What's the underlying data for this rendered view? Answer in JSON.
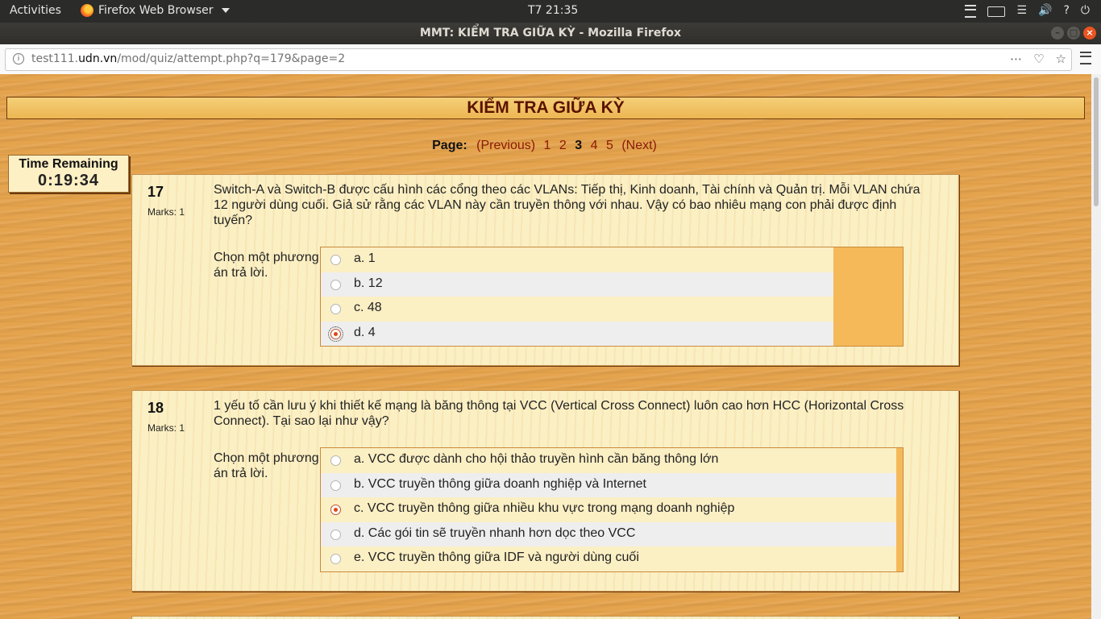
{
  "os": {
    "activities": "Activities",
    "app_name": "Firefox Web Browser",
    "clock": "T7 21:35"
  },
  "window": {
    "title": "MMT: KIỂM TRA GIỮA KỲ - Mozilla Firefox"
  },
  "browser": {
    "url_prefix": "test111.",
    "url_domain": "udn.vn",
    "url_path": "/mod/quiz/attempt.php?q=179&page=2"
  },
  "quiz": {
    "heading": "KIỂM TRA GIỮA KỲ",
    "paging": {
      "label": "Page:",
      "previous": "(Previous)",
      "pages": [
        "1",
        "2",
        "3",
        "4",
        "5"
      ],
      "current": "3",
      "next": "(Next)"
    },
    "timer": {
      "label": "Time Remaining",
      "value": "0:19:34"
    },
    "questions": [
      {
        "number": "17",
        "marks": "Marks: 1",
        "text": "Switch-A và Switch-B được cấu hình các cổng theo các VLANs: Tiếp thị, Kinh doanh, Tài chính và Quản trị. Mỗi VLAN chứa 12 người dùng cuối. Giả sử rằng các VLAN này cần truyền thông với nhau. Vậy có bao nhiêu mạng con phải được định tuyến?",
        "prompt": "Chọn một phương án trả lời.",
        "answers": [
          "a. 1",
          "b. 12",
          "c. 48",
          "d. 4"
        ],
        "selected": 3
      },
      {
        "number": "18",
        "marks": "Marks: 1",
        "text": "1 yếu tố cần lưu ý khi thiết kế mạng là băng thông tại VCC (Vertical Cross Connect) luôn cao hơn HCC (Horizontal Cross Connect). Tại sao lại như vậy?",
        "prompt": "Chọn một phương án trả lời.",
        "answers": [
          "a. VCC được dành cho hội thảo truyền hình cần băng thông lớn",
          "b. VCC truyền thông giữa doanh nghiệp và Internet",
          "c. VCC truyền thông giữa nhiều khu vực trong mạng doanh nghiệp",
          "d. Các gói tin sẽ truyền nhanh hơn dọc theo VCC",
          "e. VCC truyền thông giữa IDF và người dùng cuối"
        ],
        "selected": 2
      }
    ]
  }
}
